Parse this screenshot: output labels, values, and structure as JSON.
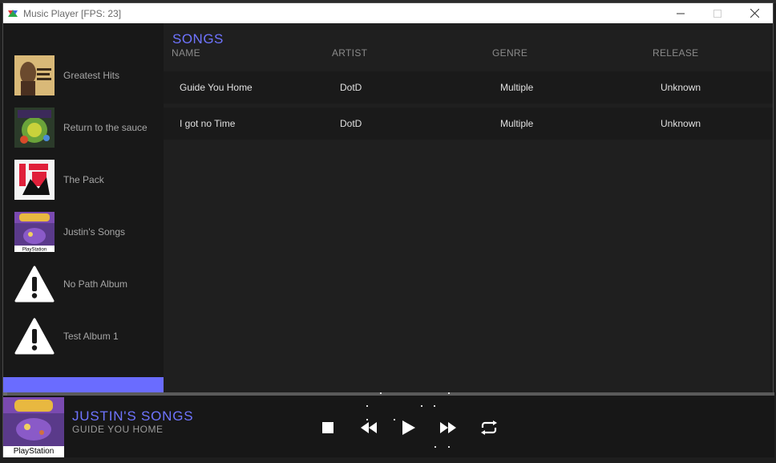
{
  "window": {
    "title": "Music Player [FPS: 23]",
    "controls": {
      "minimize": "—",
      "maximize": "☐",
      "close": "✕"
    }
  },
  "sidebar": {
    "albums": [
      {
        "name": "Greatest Hits",
        "art": "greatest-hits-cover"
      },
      {
        "name": "Return to the sauce",
        "art": "return-to-the-sauce-cover"
      },
      {
        "name": "The Pack",
        "art": "the-pack-cover"
      },
      {
        "name": "Justin's Songs",
        "art": "spyro-playstation-cover"
      },
      {
        "name": "No Path Album",
        "art": "warning-icon"
      },
      {
        "name": "Test Album 1",
        "art": "warning-icon"
      }
    ]
  },
  "main": {
    "heading": "SONGS",
    "columns": [
      "NAME",
      "ARTIST",
      "GENRE",
      "RELEASE"
    ],
    "songs": [
      {
        "name": "Guide You Home",
        "artist": "DotD",
        "genre": "Multiple",
        "release": "Unknown"
      },
      {
        "name": "I got no Time",
        "artist": "DotD",
        "genre": "Multiple",
        "release": "Unknown"
      }
    ]
  },
  "now_playing": {
    "album": "JUSTIN'S SONGS",
    "song": "GUIDE YOU HOME",
    "art_label": "PlayStation",
    "progress": 0.005
  },
  "controls": {
    "icons": [
      "stop-icon",
      "rewind-icon",
      "play-icon",
      "fast-forward-icon",
      "repeat-icon"
    ]
  },
  "colors": {
    "accent": "#6f74ff",
    "sidebar_highlight": "#6a6cff",
    "background": "#1f1f1f"
  }
}
